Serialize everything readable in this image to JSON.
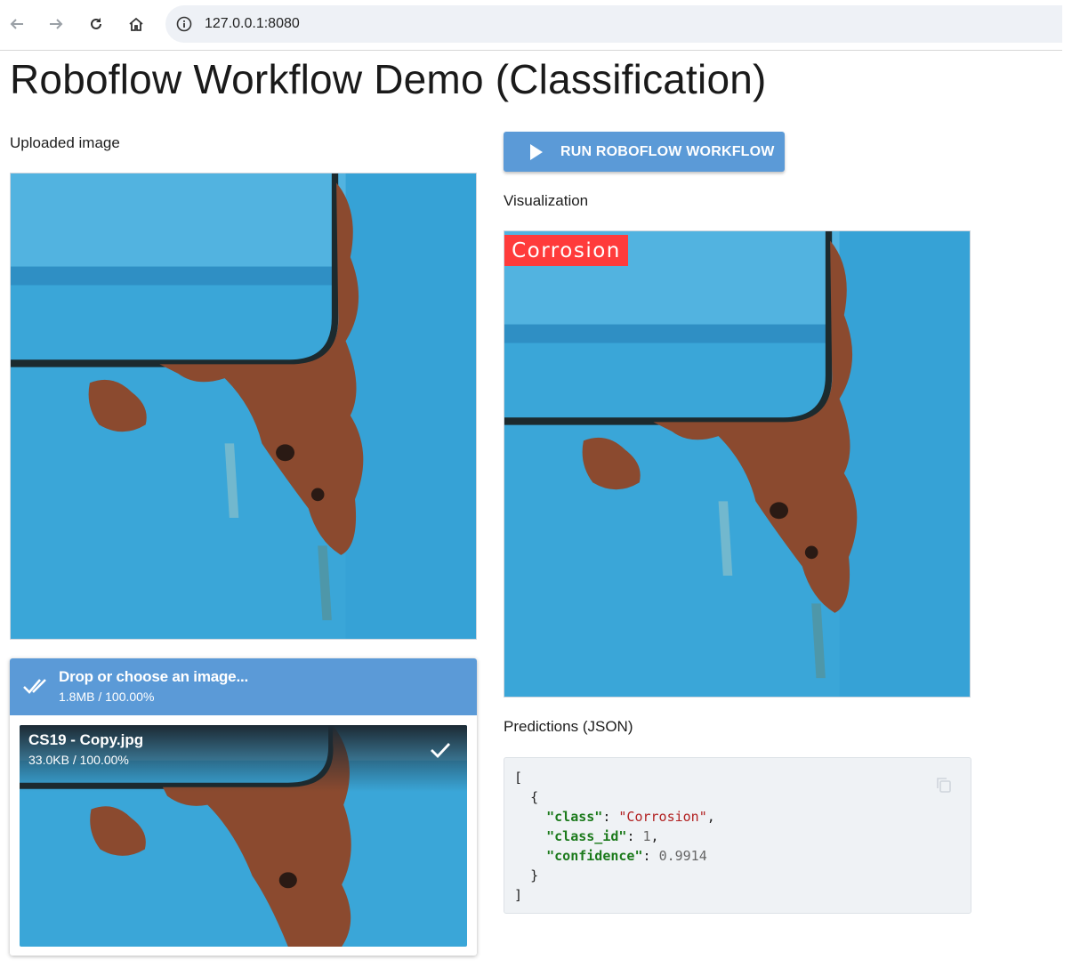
{
  "browser": {
    "url": "127.0.0.1:8080",
    "icons": [
      "back-arrow-icon",
      "forward-arrow-icon",
      "reload-icon",
      "home-icon",
      "info-icon"
    ]
  },
  "page": {
    "title": "Roboflow Workflow Demo (Classification)"
  },
  "left": {
    "uploaded_label": "Uploaded image",
    "upload": {
      "header_title": "Drop or choose an image...",
      "header_status": "1.8MB / 100.00%",
      "file": {
        "name": "CS19 - Copy.jpg",
        "status": "33.0KB / 100.00%"
      }
    }
  },
  "right": {
    "run_button": "RUN ROBOFLOW WORKFLOW",
    "visualization_label": "Visualization",
    "prediction_tag": "Corrosion",
    "predictions_label": "Predictions (JSON)",
    "json": {
      "open_bracket": "[",
      "open_brace": "{",
      "class_key": "\"class\"",
      "class_value": "\"Corrosion\"",
      "class_id_key": "\"class_id\"",
      "class_id_value": "1",
      "confidence_key": "\"confidence\"",
      "confidence_value": "0.9914",
      "close_brace": "}",
      "close_bracket": "]"
    }
  },
  "colors": {
    "accent": "#5b9ad7",
    "tag": "#ff3b3b",
    "panel_blue": "#3aa6d8",
    "rust": "#8b4a2f"
  }
}
